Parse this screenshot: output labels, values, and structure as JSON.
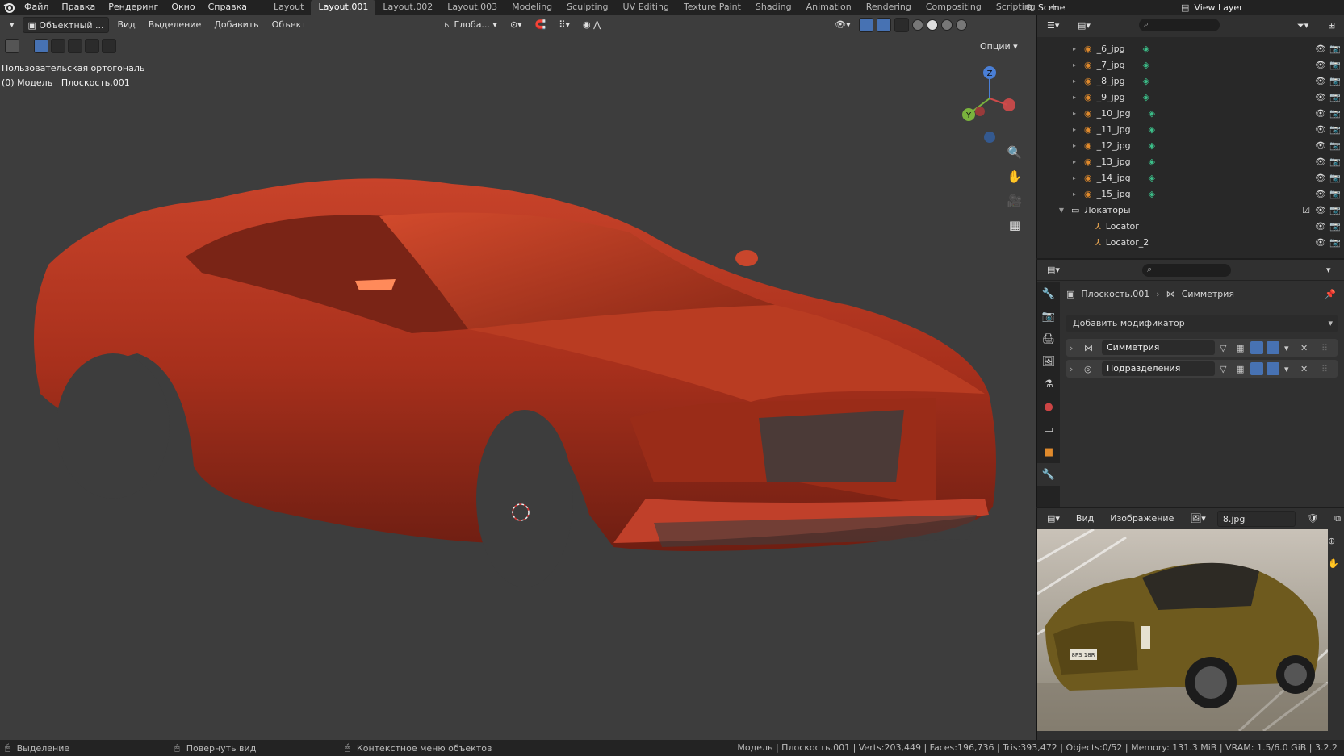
{
  "topbar": {
    "menus": [
      "Файл",
      "Правка",
      "Рендеринг",
      "Окно",
      "Справка"
    ],
    "workspaces": [
      "Layout",
      "Layout.001",
      "Layout.002",
      "Layout.003",
      "Modeling",
      "Sculpting",
      "UV Editing",
      "Texture Paint",
      "Shading",
      "Animation",
      "Rendering",
      "Compositing",
      "Scripting"
    ],
    "active_workspace": "Layout.001",
    "add_tab": "+",
    "scene": "Scene",
    "view_layer": "View Layer"
  },
  "viewport": {
    "mode": "Объектный ...",
    "menu": [
      "Вид",
      "Выделение",
      "Добавить",
      "Объект"
    ],
    "transform_orientation": "Глоба...",
    "options_label": "Опции",
    "view_name": "Пользовательская ортогональ",
    "object_info": "(0) Модель | Плоскость.001",
    "gizmo": {
      "z": "Z",
      "y": "Y"
    },
    "car_color": "#b5351e"
  },
  "outliner": {
    "rows": [
      {
        "name": "_6_jpg",
        "type": "image"
      },
      {
        "name": "_7_jpg",
        "type": "image"
      },
      {
        "name": "_8_jpg",
        "type": "image"
      },
      {
        "name": "_9_jpg",
        "type": "image"
      },
      {
        "name": "_10_jpg",
        "type": "image"
      },
      {
        "name": "_11_jpg",
        "type": "image"
      },
      {
        "name": "_12_jpg",
        "type": "image"
      },
      {
        "name": "_13_jpg",
        "type": "image"
      },
      {
        "name": "_14_jpg",
        "type": "image"
      },
      {
        "name": "_15_jpg",
        "type": "image"
      },
      {
        "name": "Локаторы",
        "type": "collection"
      },
      {
        "name": "Locator",
        "type": "empty"
      },
      {
        "name": "Locator_2",
        "type": "empty"
      }
    ]
  },
  "properties": {
    "breadcrumb_object": "Плоскость.001",
    "breadcrumb_modifier": "Симметрия",
    "add_modifier": "Добавить модификатор",
    "modifiers": [
      {
        "name": "Симметрия"
      },
      {
        "name": "Подразделения"
      }
    ]
  },
  "image_editor": {
    "menu": [
      "Вид",
      "Изображение"
    ],
    "image_name": "8.jpg",
    "plate_text": "8PS 18R",
    "car_color": "#6e5a1e"
  },
  "status": {
    "select": "Выделение",
    "rotate": "Повернуть вид",
    "context": "Контекстное меню объектов",
    "stats": "Модель | Плоскость.001 | Verts:203,449 | Faces:196,736 | Tris:393,472 | Objects:0/52 | Memory: 131.3 MiB | VRAM: 1.5/6.0 GiB | 3.2.2"
  },
  "colors": {
    "accent": "#4772b3",
    "viewport_bg": "#3d3d3d",
    "panel_bg": "#303030"
  }
}
